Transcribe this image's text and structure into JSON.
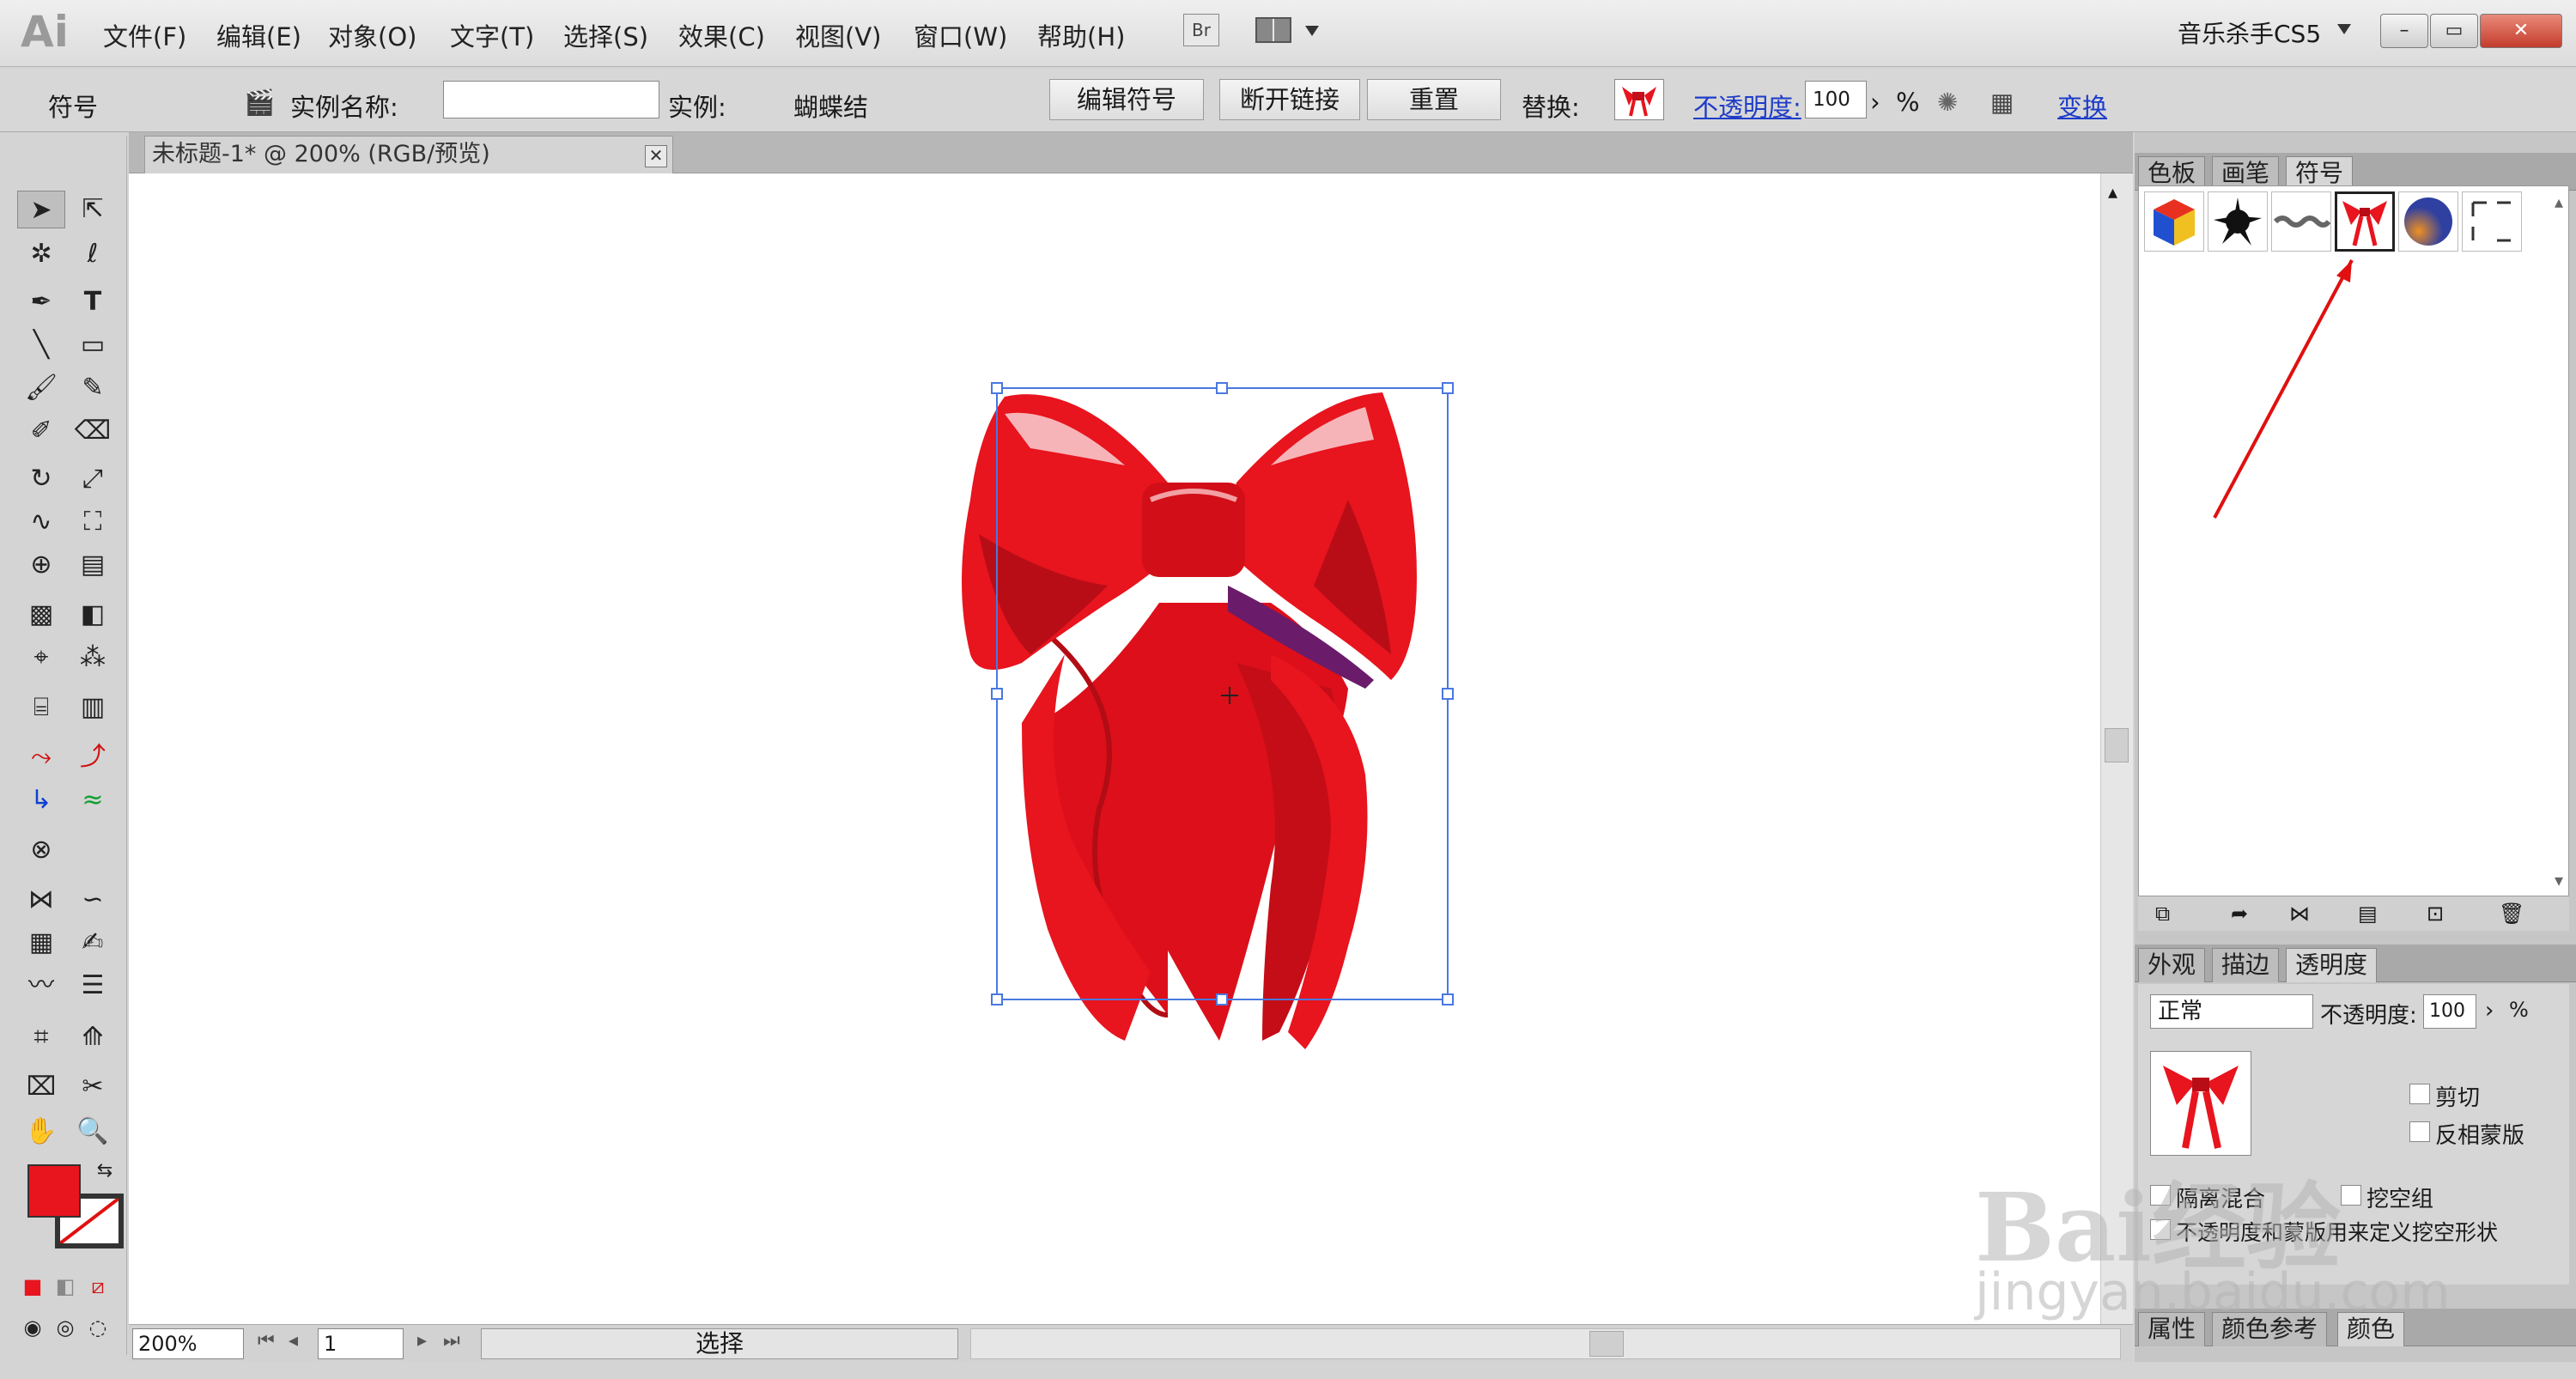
{
  "app": {
    "logo": "Ai"
  },
  "menubar": {
    "items": [
      "文件(F)",
      "编辑(E)",
      "对象(O)",
      "文字(T)",
      "选择(S)",
      "效果(C)",
      "视图(V)",
      "窗口(W)",
      "帮助(H)"
    ],
    "bridge_label": "Br",
    "workspace": "音乐杀手CS5"
  },
  "controlbar": {
    "symbol_label": "符号",
    "instance_name_label": "实例名称:",
    "instance_name_value": "",
    "instance_label": "实例:",
    "instance_value": "蝴蝶结",
    "edit_symbol": "编辑符号",
    "break_link": "断开链接",
    "reset": "重置",
    "replace_label": "替换:",
    "opacity_label": "不透明度:",
    "opacity_value": "100",
    "percent": "%",
    "transform": "变换"
  },
  "document": {
    "tab_title": "未标题-1* @ 200% (RGB/预览)",
    "close": "✕"
  },
  "statusbar": {
    "zoom": "200%",
    "page": "1",
    "status": "选择"
  },
  "panels": {
    "top_tabs": [
      "色板",
      "画笔",
      "符号"
    ],
    "mid_tabs": [
      "外观",
      "描边",
      "透明度"
    ],
    "bottom_tabs": [
      "属性",
      "颜色参考",
      "颜色"
    ],
    "blend_mode": "正常",
    "opacity_label": "不透明度:",
    "opacity_value": "100",
    "percent": "%",
    "clip": "剪切",
    "invert_mask": "反相蒙版",
    "isolate_blend": "隔离混合",
    "knockout_group": "挖空组",
    "opacity_mask_shape": "不透明度和蒙版用来定义挖空形状",
    "symbols": [
      "cube",
      "splatter",
      "rope",
      "bow",
      "orb",
      "frame"
    ]
  },
  "watermark": {
    "main": "Bai经验",
    "sub": "jingyan.baidu.com"
  },
  "colors": {
    "fill": "#e8141e",
    "selection": "#4a78e0",
    "annotation_arrow": "#e01010"
  }
}
